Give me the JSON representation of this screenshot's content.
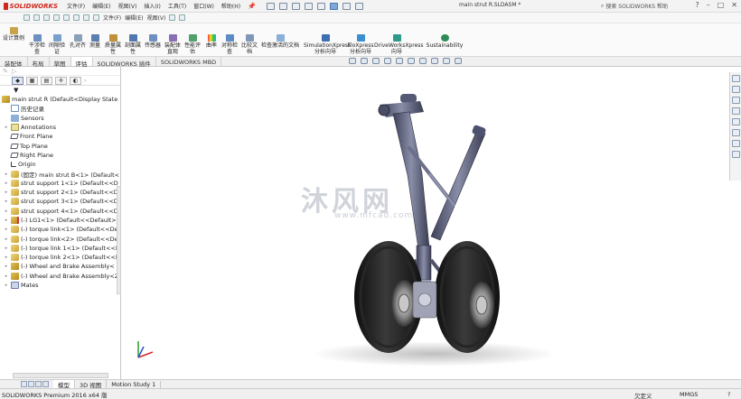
{
  "title_bar": {
    "logo_text": "SOLIDWORKS",
    "menus": [
      "文件(F)",
      "编辑(E)",
      "视图(V)",
      "插入(I)",
      "工具(T)",
      "窗口(W)",
      "帮助(H)"
    ],
    "document_title": "main strut R.SLDASM *",
    "search_placeholder": "搜索 SOLIDWORKS 帮助",
    "window_controls": [
      "?",
      "–",
      "□",
      "✕"
    ]
  },
  "toolbar_row2": {
    "items": [
      "文件(F)",
      "编辑(E)",
      "视图(V)"
    ]
  },
  "command_manager": {
    "buttons": [
      {
        "label": "设计算例",
        "icon": "study-icon"
      },
      {
        "label": "干涉检查",
        "icon": "interference-icon"
      },
      {
        "label": "间隙验证",
        "icon": "clearance-icon"
      },
      {
        "label": "孔对齐",
        "icon": "hole-align-icon"
      },
      {
        "label": "测量",
        "icon": "measure-icon"
      },
      {
        "label": "质量属性",
        "icon": "mass-props-icon"
      },
      {
        "label": "剖面属性",
        "icon": "section-props-icon"
      },
      {
        "label": "传感器",
        "icon": "sensor-icon"
      },
      {
        "label": "装配体直观",
        "icon": "asm-visual-icon"
      },
      {
        "label": "性能评估",
        "icon": "perf-icon"
      },
      {
        "label": "曲率",
        "icon": "curvature-icon"
      },
      {
        "label": "对称检查",
        "icon": "symmetry-icon"
      },
      {
        "label": "比较文档",
        "icon": "compare-icon"
      },
      {
        "label": "检查激活的文档",
        "icon": "check-doc-icon"
      },
      {
        "label": "SimulationXpress 分析向导",
        "icon": "simxpress-icon"
      },
      {
        "label": "FloXpress 分析向导",
        "icon": "floxpress-icon"
      },
      {
        "label": "DriveWorksXpress 向导",
        "icon": "driveworks-icon"
      },
      {
        "label": "Sustainability",
        "icon": "sustainability-icon"
      }
    ]
  },
  "tabs": {
    "items": [
      "装配体",
      "布局",
      "草图",
      "评估",
      "SOLIDWORKS 插件",
      "SOLIDWORKS MBD"
    ],
    "active": "评估"
  },
  "feature_tree": {
    "root": "main strut R  (Default<Display State",
    "items": [
      {
        "label": "历史记录",
        "icon": "history-icon",
        "arrow": ""
      },
      {
        "label": "Sensors",
        "icon": "sensor-icon",
        "arrow": ""
      },
      {
        "label": "Annotations",
        "icon": "annotation-icon",
        "arrow": "▸"
      },
      {
        "label": "Front Plane",
        "icon": "plane-icon",
        "arrow": ""
      },
      {
        "label": "Top Plane",
        "icon": "plane-icon",
        "arrow": ""
      },
      {
        "label": "Right Plane",
        "icon": "plane-icon",
        "arrow": ""
      },
      {
        "label": "Origin",
        "icon": "origin-icon",
        "arrow": ""
      },
      {
        "label": "(固定) main strut B<1> (Default<",
        "icon": "part-icon",
        "arrow": "▸"
      },
      {
        "label": "strut support 1<1> (Default<<D",
        "icon": "part-icon",
        "arrow": "▸"
      },
      {
        "label": "strut support 2<1> (Default<<D",
        "icon": "part-icon",
        "arrow": "▸"
      },
      {
        "label": "strut support 3<1> (Default<<D",
        "icon": "part-icon",
        "arrow": "▸"
      },
      {
        "label": "strut support 4<1> (Default<<D",
        "icon": "part-icon",
        "arrow": "▸"
      },
      {
        "label": "(-) LG1<1> (Default<<Default>_",
        "icon": "asm-icon",
        "arrow": "▸"
      },
      {
        "label": "(-) torque link<1> (Default<<De",
        "icon": "part-icon",
        "arrow": "▸"
      },
      {
        "label": "(-) torque link<2> (Default<<De",
        "icon": "part-icon",
        "arrow": "▸"
      },
      {
        "label": "(-) torque link 1<1> (Default<<I",
        "icon": "part-icon",
        "arrow": "▸"
      },
      {
        "label": "(-) torque link 2<1> (Default<<I",
        "icon": "part-icon",
        "arrow": "▸"
      },
      {
        "label": "(-) Wheel and Brake Assembly<",
        "icon": "asm-icon",
        "arrow": "▸"
      },
      {
        "label": "(-) Wheel and Brake Assembly<2",
        "icon": "asm-icon",
        "arrow": "▸"
      },
      {
        "label": "Mates",
        "icon": "mates-icon",
        "arrow": "▸"
      }
    ]
  },
  "watermark": {
    "brand": "沐风网",
    "url": "www.mfcad.com"
  },
  "bottom_tabs": {
    "items": [
      "模型",
      "3D 视图",
      "Motion Study 1"
    ],
    "active": "模型"
  },
  "status_bar": {
    "left": "SOLIDWORKS Premium 2016 x64 版",
    "state": "欠定义",
    "units": "MMGS",
    "help": "?"
  },
  "colors": {
    "accent": "#d0261c",
    "tree_root": "#b38a1c",
    "viewport_bg": "#ffffff",
    "model_metal": "#5a5e78",
    "tire": "#1c1c1c"
  }
}
